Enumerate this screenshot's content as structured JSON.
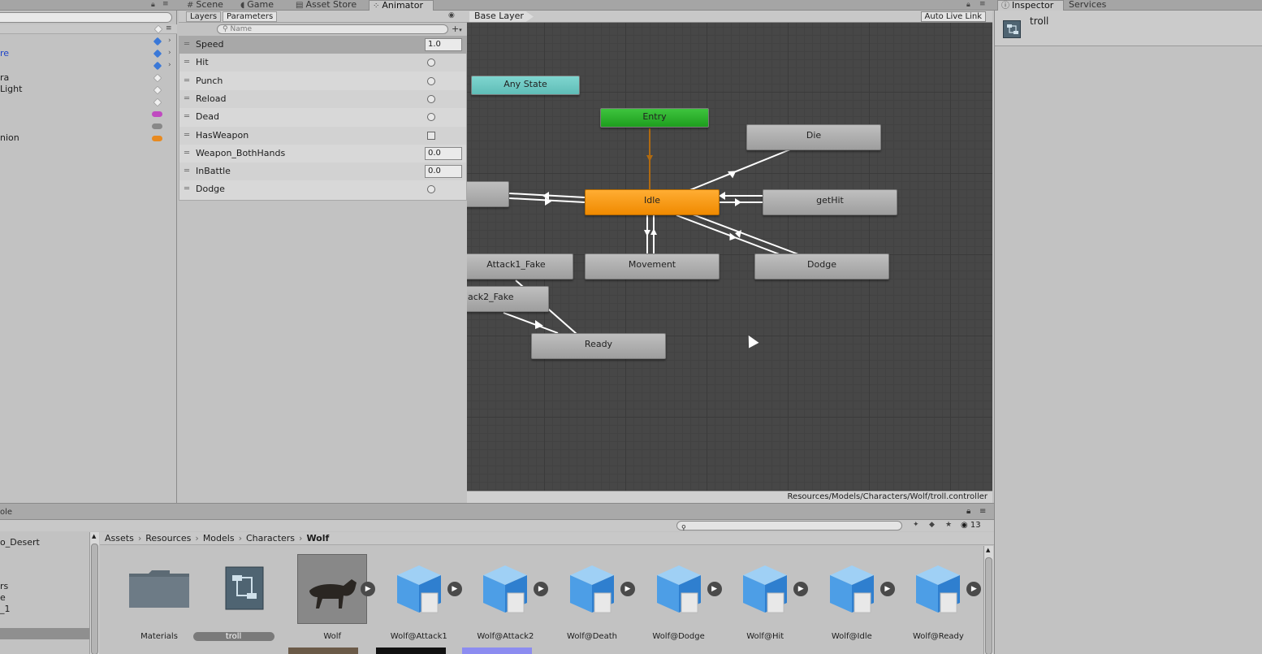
{
  "tabs": {
    "scene": "Scene",
    "game": "Game",
    "asset_store": "Asset Store",
    "animator": "Animator",
    "inspector": "Inspector",
    "services": "Services"
  },
  "hierarchy": {
    "items": [
      {
        "label": "re",
        "color": "#1e44c8"
      },
      {
        "label": "ra",
        "color": "#1c1c1c"
      },
      {
        "label": "Light",
        "color": "#1c1c1c"
      },
      {
        "label": "nion",
        "color": "#1c1c1c"
      }
    ]
  },
  "params": {
    "tab_layers": "Layers",
    "tab_parameters": "Parameters",
    "search_placeholder": "Name",
    "rows": [
      {
        "name": "Speed",
        "type": "float",
        "value": "1.0"
      },
      {
        "name": "Hit",
        "type": "trigger",
        "value": ""
      },
      {
        "name": "Punch",
        "type": "trigger",
        "value": ""
      },
      {
        "name": "Reload",
        "type": "trigger",
        "value": ""
      },
      {
        "name": "Dead",
        "type": "trigger",
        "value": ""
      },
      {
        "name": "HasWeapon",
        "type": "bool",
        "value": ""
      },
      {
        "name": "Weapon_BothHands",
        "type": "float",
        "value": "0.0"
      },
      {
        "name": "InBattle",
        "type": "float",
        "value": "0.0"
      },
      {
        "name": "Dodge",
        "type": "trigger",
        "value": ""
      }
    ]
  },
  "animator": {
    "layer": "Base Layer",
    "auto_live_link": "Auto Live Link",
    "path": "Resources/Models/Characters/Wolf/troll.controller",
    "states": {
      "any_state": "Any State",
      "entry": "Entry",
      "die": "Die",
      "idle": "Idle",
      "get_hit": "getHit",
      "attack1_fake": "Attack1_Fake",
      "movement": "Movement",
      "dodge": "Dodge",
      "attack2_fake": "ack2_Fake",
      "ready": "Ready"
    },
    "colors": {
      "any": "#6ccac4",
      "entry": "#2db32d",
      "idle": "#f7961a",
      "default": "#a8a8a8"
    }
  },
  "inspector": {
    "object_name": "troll"
  },
  "project": {
    "panel_title": "ole",
    "asset_count": "13",
    "tree": [
      "o_Desert",
      "rs",
      "e",
      "_1"
    ],
    "breadcrumb": [
      "Assets",
      "Resources",
      "Models",
      "Characters",
      "Wolf"
    ],
    "assets": [
      {
        "name": "Materials",
        "kind": "folder"
      },
      {
        "name": "troll",
        "kind": "controller"
      },
      {
        "name": "Wolf",
        "kind": "model"
      },
      {
        "name": "Wolf@Attack1",
        "kind": "prefab"
      },
      {
        "name": "Wolf@Attack2",
        "kind": "prefab"
      },
      {
        "name": "Wolf@Death",
        "kind": "prefab"
      },
      {
        "name": "Wolf@Dodge",
        "kind": "prefab"
      },
      {
        "name": "Wolf@Hit",
        "kind": "prefab"
      },
      {
        "name": "Wolf@Idle",
        "kind": "prefab"
      },
      {
        "name": "Wolf@Ready",
        "kind": "prefab"
      }
    ]
  }
}
